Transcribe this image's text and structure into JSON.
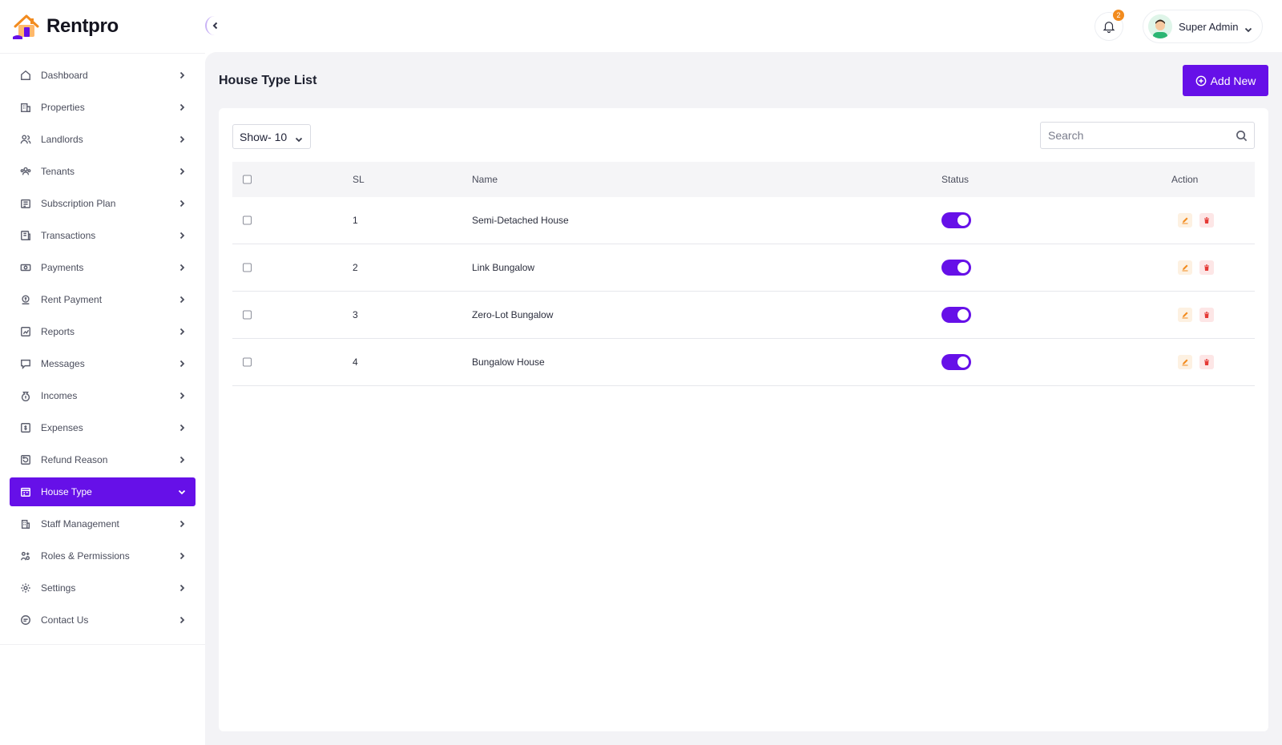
{
  "brand": {
    "name": "Rentpro"
  },
  "colors": {
    "accent": "#6610e8",
    "badge": "#f28b1e",
    "edit": "#f28b1e",
    "delete": "#e53935"
  },
  "sidebar": {
    "items": [
      {
        "label": "Dashboard",
        "icon": "home-icon"
      },
      {
        "label": "Properties",
        "icon": "building-icon"
      },
      {
        "label": "Landlords",
        "icon": "users-icon"
      },
      {
        "label": "Tenants",
        "icon": "users-group-icon"
      },
      {
        "label": "Subscription Plan",
        "icon": "subscription-icon"
      },
      {
        "label": "Transactions",
        "icon": "transactions-icon"
      },
      {
        "label": "Payments",
        "icon": "payment-icon"
      },
      {
        "label": "Rent Payment",
        "icon": "rent-payment-icon"
      },
      {
        "label": "Reports",
        "icon": "reports-icon"
      },
      {
        "label": "Messages",
        "icon": "message-icon"
      },
      {
        "label": "Incomes",
        "icon": "money-bag-icon"
      },
      {
        "label": "Expenses",
        "icon": "expenses-icon"
      },
      {
        "label": "Refund Reason",
        "icon": "refund-icon"
      },
      {
        "label": "House Type",
        "icon": "house-type-icon",
        "active": true
      },
      {
        "label": "Staff Management",
        "icon": "staff-icon"
      },
      {
        "label": "Roles & Permissions",
        "icon": "roles-icon"
      },
      {
        "label": "Settings",
        "icon": "gear-icon"
      },
      {
        "label": "Contact Us",
        "icon": "contact-icon"
      }
    ]
  },
  "header": {
    "notification_count": "2",
    "user_name": "Super Admin"
  },
  "main": {
    "title": "House Type List",
    "add_label": "Add New",
    "show_label": "Show- 10",
    "search_placeholder": "Search",
    "columns": {
      "sl": "SL",
      "name": "Name",
      "status": "Status",
      "action": "Action"
    },
    "rows": [
      {
        "sl": "1",
        "name": "Semi-Detached House",
        "status_on": true
      },
      {
        "sl": "2",
        "name": "Link Bungalow",
        "status_on": true
      },
      {
        "sl": "3",
        "name": "Zero-Lot Bungalow",
        "status_on": true
      },
      {
        "sl": "4",
        "name": "Bungalow House",
        "status_on": true
      }
    ]
  }
}
